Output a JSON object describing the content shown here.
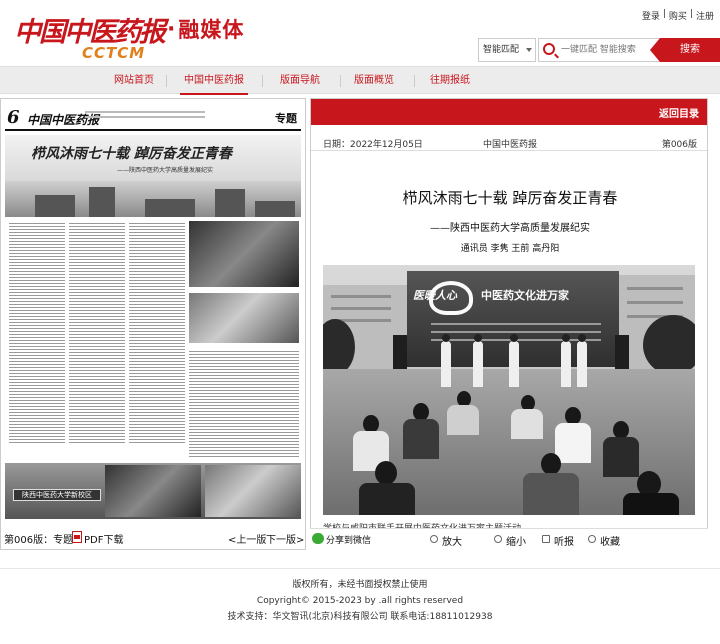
{
  "brand": {
    "logo_main": "中国中医药报",
    "logo_dot": "·",
    "logo_sub": "融媒体",
    "logo_mark": "CCTCM"
  },
  "top_links": {
    "login": "登录",
    "sep1": "|",
    "buy": "购买",
    "sep2": "|",
    "register": "注册"
  },
  "search": {
    "mode": "智能匹配",
    "placeholder": "一键匹配 智能搜索",
    "button": "搜索"
  },
  "nav": {
    "items": [
      {
        "label": "网站首页"
      },
      {
        "label": "中国中医药报"
      },
      {
        "label": "版面导航"
      },
      {
        "label": "版面概览"
      },
      {
        "label": "往期报纸"
      }
    ],
    "active_index": 1
  },
  "newspaper": {
    "page_number": "6",
    "masthead": "中国中医药报",
    "section": "专题",
    "headline": "栉风沐雨七十载 踔厉奋发正青春",
    "subheadline": "——陕西中医药大学高质量发展纪实",
    "banner_caption": "陕西中医药大学新校区"
  },
  "left_bar": {
    "page_label": "第006版：专题",
    "pdf": "PDF下载",
    "prev": "<上一版",
    "next": "下一版>"
  },
  "article": {
    "back": "返回目录",
    "date": "日期：2022年12月05日",
    "paper": "中国中医药报",
    "page": "第006版",
    "title": "栉风沐雨七十载 踔厉奋发正青春",
    "subtitle": "——陕西中医药大学高质量发展纪实",
    "authors": "通讯员 李隽 王前 高丹阳",
    "photo_stage_left": "医暖人心",
    "photo_stage_right": "中医药文化进万家",
    "body_preview": "学校与咸阳市联手开展中医药文化进万家主题活动"
  },
  "toolbar": {
    "share": "分享到微信",
    "zoom_in": "放大",
    "zoom_out": "缩小",
    "listen": "听报",
    "favorite": "收藏"
  },
  "footer": {
    "rights": "版权所有，未经书面授权禁止使用",
    "copyright": "Copyright© 2015-2023 by .all rights reserved",
    "support": "技术支持：华文智讯(北京)科技有限公司 联系电话:18811012938"
  },
  "colors": {
    "brand_red": "#c8161d",
    "nav_bg": "#ececec"
  }
}
